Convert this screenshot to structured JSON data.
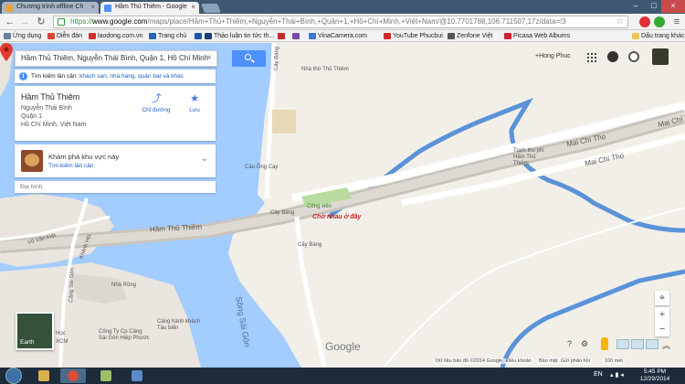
{
  "browser": {
    "tabs": [
      {
        "title": "Chương trình offline Ch",
        "color": "#e8a33a"
      },
      {
        "title": "Hầm Thủ Thiêm - Google",
        "color": "#4d90fe"
      }
    ],
    "url": "https://www.google.com/maps/place/Hầm+Thủ+Thiêm,+Nguyễn+Thái+Bình,+Quận+1,+Hồ+Chí+Minh,+Việt+Nam/@10.7701788,106.711507,17z/data=!3",
    "url_scheme": "https://",
    "url_host": "www.google.com",
    "url_path": "/maps/place/Hầm+Thủ+Thiêm,+Nguyễn+Thái+Bình,+Quận+1,+Hồ+Chí+Minh,+Việt+Nam/@10.7701788,106.711507,17z/data=!3",
    "bookmarks": [
      {
        "label": "Ứng dụng",
        "color": "#6a7fa0"
      },
      {
        "label": "Diễn đàn",
        "color": "#d94a3a"
      },
      {
        "label": "laodong.com.vn",
        "color": "#c33"
      },
      {
        "label": "Trang chủ",
        "color": "#2a62b5"
      },
      {
        "label": "",
        "color": "#1e56a8"
      },
      {
        "label": "Thảo luận tin tức th...",
        "color": "#1a3c7a"
      },
      {
        "label": "",
        "color": "#c02a2a"
      },
      {
        "label": "",
        "color": "#7a4ab0"
      },
      {
        "label": "VinaCamera.com",
        "color": "#3a7ad0"
      },
      {
        "label": "YouTube Phucbui",
        "color": "#d62a2a"
      },
      {
        "label": "Zenfone Việt",
        "color": "#555"
      },
      {
        "label": "Picasa Web Albums",
        "color": "#c23"
      },
      {
        "label": "Dấu trang khác",
        "color": "#e9c45a"
      }
    ]
  },
  "maps": {
    "search_value": "Hầm Thủ Thiêm, Nguyễn Thái Bình, Quận 1, Hồ Chí Minh",
    "nearby_prefix": "Tìm kiếm lân cận:",
    "nearby_links": "khách sạn, nhà hàng, quán bar và khác",
    "place": {
      "name": "Hầm Thủ Thiêm",
      "address1": "Nguyễn Thái Bình",
      "address2": "Quận 1",
      "address3": "Hồ Chí Minh, Việt Nam",
      "directions_label": "Chỉ đường",
      "save_label": "Lưu"
    },
    "explore": {
      "title": "Khám phá khu vực này",
      "link": "Tìm kiếm lân cận"
    },
    "dianinh": "Địa hình",
    "account_place": "+Hong Phuc",
    "earth_label": "Earth",
    "annotation": "Chờ nhau ở đây",
    "logo": "Google",
    "map_labels": {
      "tunnel": "Hầm Thủ Thiêm",
      "river": "Sông Sài Gòn",
      "mai_chi_tho_1": "Mai Chí Thọ",
      "mai_chi_tho_2": "Mai Chí Thọ",
      "mai_chi_tho_3": "Mai Chí Thọ",
      "cay_bang_1": "Cây Bàng",
      "cay_bang_2": "Cây Bàng",
      "cay_bang_3": "Cây Bàng",
      "cau_ong_cay": "Cầu Ông Cạy",
      "nha_tho": "Nhà thờ Thủ Thiêm",
      "tram_thu_phi": "Trạm thu phí Hầm Thủ Thiêm",
      "cong_vien": "Công viên",
      "nha_rong": "Nhà Rồng",
      "cty_cang": "Công Ty Cp Cảng Sài Gòn Hiệp Phước",
      "cang_khach": "Cảng hành khách Tàu biển",
      "vo_van_kiet": "Võ Văn Kiệt",
      "cang_sg": "Cảng Sài Gòn",
      "khanh_hoi": "Khánh Hội",
      "dt": "Dt",
      "hoc": "Học",
      "xcm": "XCM"
    },
    "footer": {
      "data": "Dữ liệu bản đồ ©2014 Google",
      "terms": "Điều khoản",
      "privacy": "Bảo mật",
      "feedback": "Gửi phản hồi",
      "scale": "100 mét"
    }
  },
  "taskbar": {
    "lang": "EN",
    "time": "5:45 PM",
    "date": "12/29/2014"
  },
  "colors": {
    "water": "#a3ccff",
    "land": "#f2efe9",
    "road": "#ffffff",
    "accent": "#4d90fe",
    "river_thin": "#5b93d8"
  }
}
